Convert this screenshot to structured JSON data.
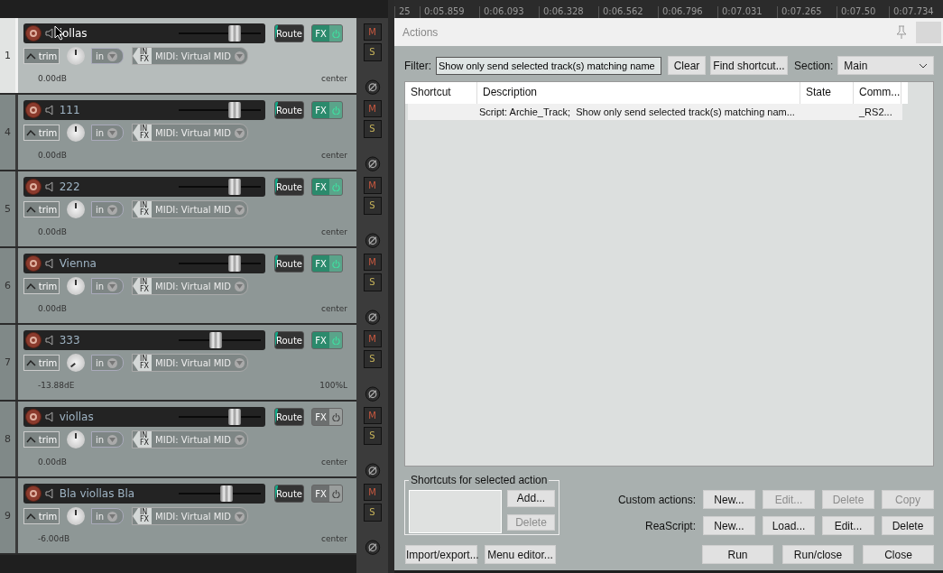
{
  "ruler": [
    "25",
    "0:05.859",
    "0:06.093",
    "0:06.328",
    "0:06.562",
    "0:06.796",
    "0:07.031",
    "0:07.265",
    "0:07.50",
    "0:07.734"
  ],
  "tracks": [
    {
      "number": "1",
      "name": "iollas",
      "cursor": true,
      "selected": true,
      "level": 0.68,
      "route": "Route",
      "fx": "FX",
      "fx_on": true,
      "trim": "trim",
      "input": "in",
      "in_label": "IN",
      "fx_label": "FX",
      "midi": "MIDI: Virtual MID",
      "volume": "0.00dB",
      "pan": "center",
      "mute": "M",
      "solo": "S"
    },
    {
      "number": "4",
      "name": "111",
      "cursor": false,
      "selected": false,
      "level": 0.68,
      "route": "Route",
      "fx": "FX",
      "fx_on": true,
      "trim": "trim",
      "input": "in",
      "in_label": "IN",
      "fx_label": "FX",
      "midi": "MIDI: Virtual MID",
      "volume": "0.00dB",
      "pan": "center",
      "mute": "M",
      "solo": "S"
    },
    {
      "number": "5",
      "name": "222",
      "cursor": false,
      "selected": false,
      "level": 0.68,
      "route": "Route",
      "fx": "FX",
      "fx_on": true,
      "trim": "trim",
      "input": "in",
      "in_label": "IN",
      "fx_label": "FX",
      "midi": "MIDI: Virtual MID",
      "volume": "0.00dB",
      "pan": "center",
      "mute": "M",
      "solo": "S"
    },
    {
      "number": "6",
      "name": "Vienna",
      "cursor": false,
      "selected": false,
      "level": 0.68,
      "route": "Route",
      "fx": "FX",
      "fx_on": true,
      "trim": "trim",
      "input": "in",
      "in_label": "IN",
      "fx_label": "FX",
      "midi": "MIDI: Virtual MID",
      "volume": "0.00dB",
      "pan": "center",
      "mute": "M",
      "solo": "S"
    },
    {
      "number": "7",
      "name": "333",
      "cursor": false,
      "selected": false,
      "level": 0.45,
      "route": "Route",
      "fx": "FX",
      "fx_on": true,
      "trim": "trim",
      "input": "in",
      "in_label": "IN",
      "fx_label": "FX",
      "midi": "MIDI: Virtual MID",
      "volume": "-13.88dE",
      "pan": "100%L",
      "mute": "M",
      "solo": "S"
    },
    {
      "number": "8",
      "name": "viollas",
      "cursor": false,
      "selected": false,
      "level": 0.68,
      "route": "Route",
      "fx": "FX",
      "fx_on": false,
      "trim": "trim",
      "input": "in",
      "in_label": "IN",
      "fx_label": "FX",
      "midi": "MIDI: Virtual MID",
      "volume": "0.00dB",
      "pan": "center",
      "mute": "M",
      "solo": "S"
    },
    {
      "number": "9",
      "name": "Bla viollas Bla",
      "cursor": false,
      "selected": false,
      "level": 0.58,
      "route": "Route",
      "fx": "FX",
      "fx_on": false,
      "trim": "trim",
      "input": "in",
      "in_label": "IN",
      "fx_label": "FX",
      "midi": "MIDI: Virtual MID",
      "volume": "-6.00dB",
      "pan": "center",
      "mute": "M",
      "solo": "S"
    }
  ],
  "actions": {
    "title": "Actions",
    "filter_label": "Filter:",
    "filter_value": "Show only send selected track(s) matching name",
    "clear": "Clear",
    "find_shortcut": "Find shortcut...",
    "section_label": "Section:",
    "section_value": "Main",
    "columns": [
      "Shortcut",
      "Description",
      "State",
      "Comm..."
    ],
    "rows": [
      {
        "description": "Script: Archie_Track;  Show only send selected track(s) matching nam...",
        "command": "_RS2...",
        "selected": true
      }
    ],
    "shortcuts_group": {
      "title": "Shortcuts for selected action",
      "buttons": [
        {
          "label": "Add...",
          "disabled": false
        },
        {
          "label": "Delete",
          "disabled": true
        }
      ]
    },
    "custom_actions": {
      "label": "Custom actions:",
      "buttons": [
        {
          "label": "New...",
          "disabled": false
        },
        {
          "label": "Edit...",
          "disabled": true
        },
        {
          "label": "Delete",
          "disabled": true
        },
        {
          "label": "Copy",
          "disabled": true
        }
      ]
    },
    "reascript": {
      "label": "ReaScript:",
      "buttons": [
        {
          "label": "New...",
          "disabled": false
        },
        {
          "label": "Load...",
          "disabled": false
        },
        {
          "label": "Edit...",
          "disabled": false
        },
        {
          "label": "Delete",
          "disabled": false
        }
      ]
    },
    "bottom_left": [
      "Import/export...",
      "Menu editor..."
    ],
    "bottom_right": [
      "Run",
      "Run/close",
      "Close"
    ]
  }
}
